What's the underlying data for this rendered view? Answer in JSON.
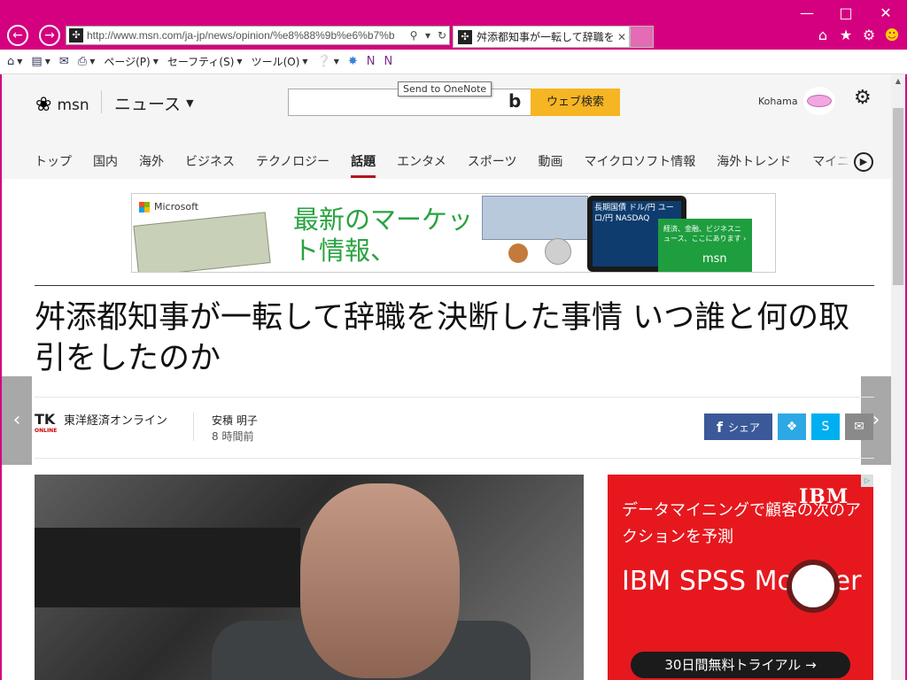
{
  "browser": {
    "url": "http://www.msn.com/ja-jp/news/opinion/%e8%88%9b%e6%b7%b",
    "tab_title": "舛添都知事が一転して辞職を...",
    "tooltip": "Send to OneNote",
    "accent_color": "#d5007f"
  },
  "commandbar": {
    "page": "ページ(P)",
    "safety": "セーフティ(S)",
    "tools": "ツール(O)"
  },
  "msn": {
    "logo": "msn",
    "section": "ニュース",
    "search_button": "ウェブ検索",
    "user_name": "Kohama",
    "tabs": [
      "トップ",
      "国内",
      "海外",
      "ビジネス",
      "テクノロジー",
      "話題",
      "エンタメ",
      "スポーツ",
      "動画",
      "マイクロソフト情報",
      "海外トレンド",
      "マイニ"
    ],
    "active_tab_index": 5
  },
  "banner": {
    "brand": "Microsoft",
    "headline": "最新のマーケット情報、",
    "phone_text": "長期国債 ドル/円 ユーロ/円 NASDAQ",
    "green_text": "経済、金融、ビジネスニュース、ここにあります ›",
    "green_logo": "msn"
  },
  "article": {
    "title": "舛添都知事が一転して辞職を決断した事情 いつ誰と何の取引をしたのか",
    "source_logo": "TK",
    "source_logo_sub": "ONLINE",
    "source_name": "東洋経済オンライン",
    "author": "安積 明子",
    "time": "8 時間前",
    "share_label": "シェア"
  },
  "ad": {
    "brand": "IBM",
    "copy": "データマイニングで顧客の次のアクションを予測",
    "product": "IBM SPSS Modeler",
    "cta": "30日間無料トライアル →"
  }
}
